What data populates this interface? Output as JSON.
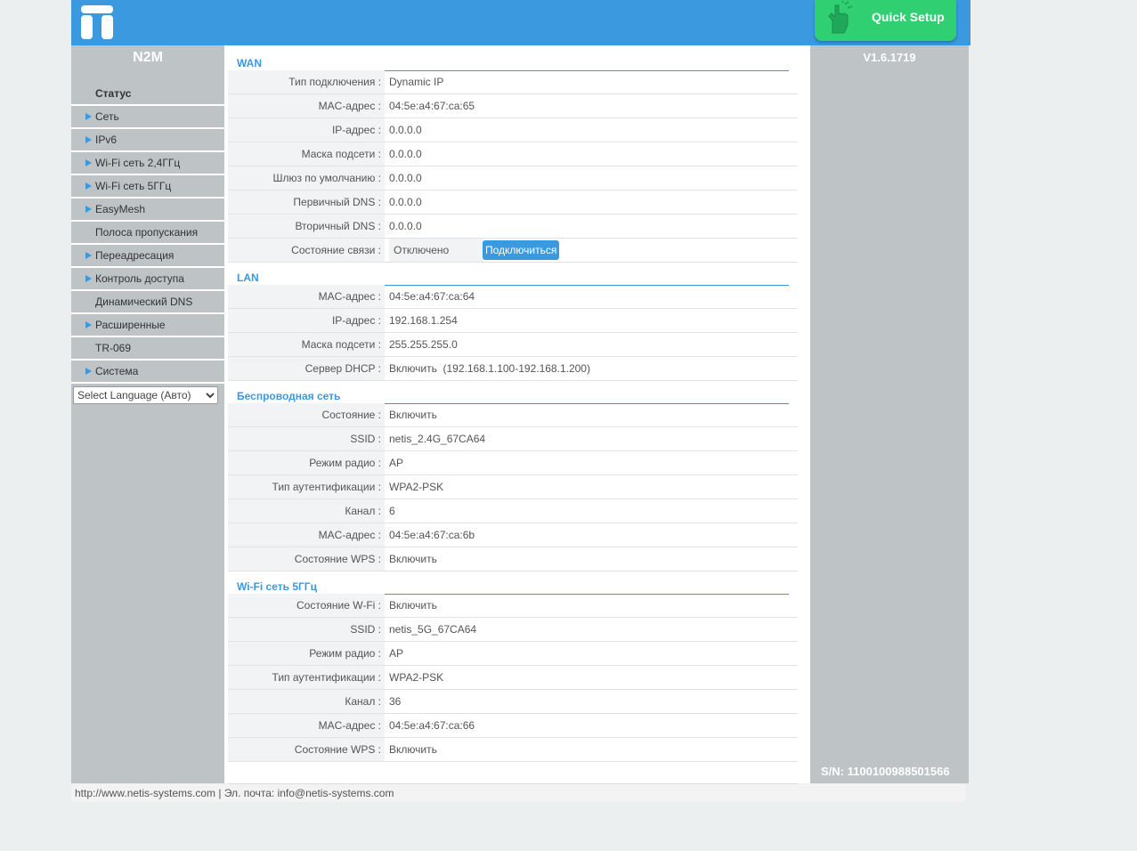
{
  "header": {
    "quick_setup_label": "Quick Setup",
    "brand_color": "#3b99df",
    "quick_setup_color": "#2fcf72"
  },
  "sidebar": {
    "model": "N2M",
    "items": [
      {
        "label": "Статус",
        "has_arrow": false,
        "active": true
      },
      {
        "label": "Сеть",
        "has_arrow": true
      },
      {
        "label": "IPv6",
        "has_arrow": true
      },
      {
        "label": "Wi-Fi сеть 2,4ГГц",
        "has_arrow": true
      },
      {
        "label": "Wi-Fi сеть 5ГГц",
        "has_arrow": true
      },
      {
        "label": "EasyMesh",
        "has_arrow": true
      },
      {
        "label": "Полоса пропускания",
        "has_arrow": false
      },
      {
        "label": "Переадресация",
        "has_arrow": true
      },
      {
        "label": "Контроль доступа",
        "has_arrow": true
      },
      {
        "label": "Динамический DNS",
        "has_arrow": false
      },
      {
        "label": "Расширенные",
        "has_arrow": true
      },
      {
        "label": "TR-069",
        "has_arrow": false
      },
      {
        "label": "Система",
        "has_arrow": true
      }
    ],
    "language_select": "Select Language (Авто)"
  },
  "wan": {
    "title": "WAN",
    "connection_type_label": "Тип подключения :",
    "connection_type": "Dynamic IP",
    "mac_label": "MAC-адрес :",
    "mac": "04:5e:a4:67:ca:65",
    "ip_label": "IP-адрес :",
    "ip": "0.0.0.0",
    "mask_label": "Маска подсети :",
    "mask": "0.0.0.0",
    "gateway_label": "Шлюз по умолчанию :",
    "gateway": "0.0.0.0",
    "dns1_label": "Первичный DNS :",
    "dns1": "0.0.0.0",
    "dns2_label": "Вторичный DNS :",
    "dns2": "0.0.0.0",
    "link_label": "Состояние связи :",
    "link_status": "Отключено",
    "connect_button": "Подключиться"
  },
  "lan": {
    "title": "LAN",
    "mac_label": "MAC-адрес :",
    "mac": "04:5e:a4:67:ca:64",
    "ip_label": "IP-адрес :",
    "ip": "192.168.1.254",
    "mask_label": "Маска подсети :",
    "mask": "255.255.255.0",
    "dhcp_label": "Сервер DHCP :",
    "dhcp": "Включить  (192.168.1.100-192.168.1.200)"
  },
  "wireless": {
    "title": "Беспроводная сеть",
    "state_label": "Состояние :",
    "state": "Включить",
    "ssid_label": "SSID :",
    "ssid": "netis_2.4G_67CA64",
    "mode_label": "Режим радио :",
    "mode": "AP",
    "auth_label": "Тип аутентификации :",
    "auth": "WPA2-PSK",
    "channel_label": "Канал :",
    "channel": "6",
    "mac_label": "MAC-адрес :",
    "mac": "04:5e:a4:67:ca:6b",
    "wps_label": "Состояние WPS :",
    "wps": "Включить"
  },
  "wifi5": {
    "title": "Wi-Fi сеть 5ГГц",
    "state_label": "Состояние W-Fi :",
    "state": "Включить",
    "ssid_label": "SSID :",
    "ssid": "netis_5G_67CA64",
    "mode_label": "Режим радио :",
    "mode": "AP",
    "auth_label": "Тип аутентификации :",
    "auth": "WPA2-PSK",
    "channel_label": "Канал :",
    "channel": "36",
    "mac_label": "MAC-адрес :",
    "mac": "04:5e:a4:67:ca:66",
    "wps_label": "Состояние WPS :",
    "wps": "Включить"
  },
  "rightbar": {
    "version": "V1.6.1719",
    "serial": "S/N: 1100100988501566"
  },
  "footer": {
    "text": "http://www.netis-systems.com | Эл. почта: info@netis-systems.com"
  }
}
